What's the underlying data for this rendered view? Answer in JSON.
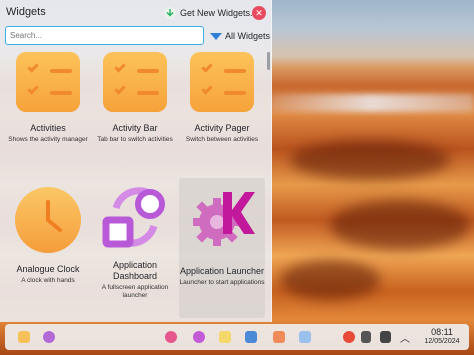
{
  "panel": {
    "title": "Widgets",
    "get_new_label": "Get New Widgets...",
    "search_placeholder": "Search...",
    "filter_label": "All Widgets"
  },
  "widgets": [
    {
      "name": "Activities",
      "description": "Shows the activity manager",
      "icon": "activities-icon"
    },
    {
      "name": "Activity Bar",
      "description": "Tab bar to switch activities",
      "icon": "activity-bar-icon"
    },
    {
      "name": "Activity Pager",
      "description": "Switch between activities",
      "icon": "activity-pager-icon"
    },
    {
      "name": "Analogue Clock",
      "description": "A clock with hands",
      "icon": "analogue-clock-icon"
    },
    {
      "name": "Application Dashboard",
      "description": "A fullscreen application launcher",
      "icon": "application-dashboard-icon"
    },
    {
      "name": "Application Launcher",
      "description": "Launcher to start applications",
      "icon": "application-launcher-icon",
      "selected": true
    }
  ],
  "taskbar": {
    "time": "08:11",
    "date": "12/05/2024"
  },
  "colors": {
    "accent": "#3daee9",
    "close": "#e84a5f",
    "checklist": "#f6a23a",
    "dashboard": "#b85ad8",
    "launcher": "#d43ca8"
  }
}
